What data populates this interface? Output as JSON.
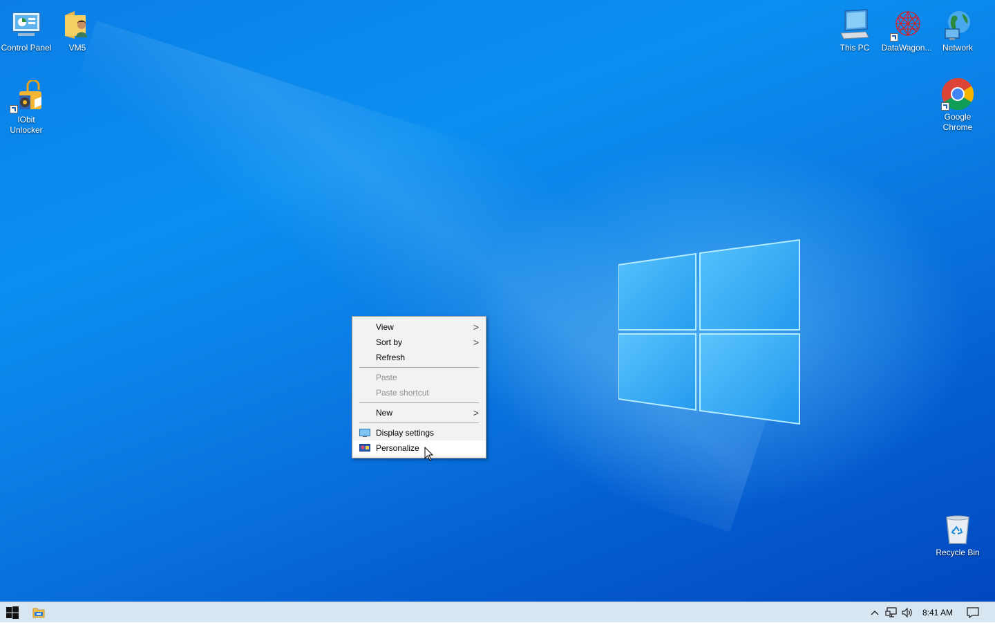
{
  "desktop": {
    "icons_left": [
      {
        "label": "Control Panel",
        "icon": "control-panel-icon"
      },
      {
        "label": "VM5",
        "icon": "user-folder-icon"
      },
      {
        "label": "IObit Unlocker",
        "icon": "iobit-unlocker-icon"
      }
    ],
    "icons_right": [
      {
        "label": "This PC",
        "icon": "this-pc-icon"
      },
      {
        "label": "DataWagon...",
        "icon": "datawagon-icon"
      },
      {
        "label": "Network",
        "icon": "network-icon"
      },
      {
        "label": "Google Chrome",
        "icon": "chrome-icon"
      },
      {
        "label": "Recycle Bin",
        "icon": "recycle-bin-icon"
      }
    ]
  },
  "context_menu": {
    "items": [
      {
        "label": "View",
        "submenu": true,
        "disabled": false
      },
      {
        "label": "Sort by",
        "submenu": true,
        "disabled": false
      },
      {
        "label": "Refresh",
        "submenu": false,
        "disabled": false
      },
      {
        "label": "Paste",
        "submenu": false,
        "disabled": true
      },
      {
        "label": "Paste shortcut",
        "submenu": false,
        "disabled": true
      },
      {
        "label": "New",
        "submenu": true,
        "disabled": false
      },
      {
        "label": "Display settings",
        "submenu": false,
        "disabled": false,
        "icon": "display-icon"
      },
      {
        "label": "Personalize",
        "submenu": false,
        "disabled": false,
        "icon": "personalize-icon",
        "hovered": true
      }
    ],
    "submenu_glyph": ">"
  },
  "taskbar": {
    "clock": "8:41 AM"
  },
  "colors": {
    "desktop_blue": "#0a7ee6",
    "taskbar_bg": "#d8e6f2",
    "menu_bg": "#f2f2f2"
  }
}
